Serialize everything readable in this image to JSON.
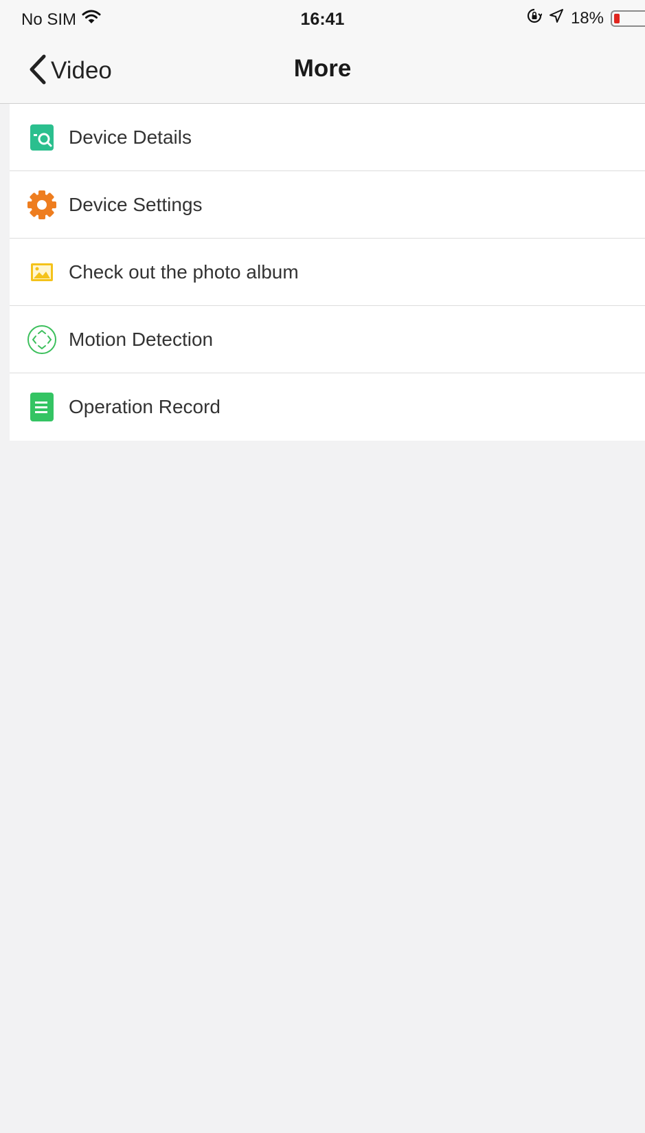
{
  "status_bar": {
    "carrier": "No SIM",
    "time": "16:41",
    "battery_percent_text": "18%",
    "battery_level": 0.18,
    "icons": [
      "wifi-icon",
      "rotation-lock-icon",
      "location-arrow-icon",
      "battery-icon"
    ]
  },
  "navbar": {
    "back_label": "Video",
    "title": "More"
  },
  "menu": {
    "items": [
      {
        "label": "Device Details",
        "icon": "device-details-icon",
        "color": "#2bbf8e"
      },
      {
        "label": "Device Settings",
        "icon": "gear-icon",
        "color": "#ee7d1f"
      },
      {
        "label": "Check out the photo album",
        "icon": "photo-album-icon",
        "color": "#f4c21a"
      },
      {
        "label": "Motion Detection",
        "icon": "motion-detection-icon",
        "color": "#3cbf5c"
      },
      {
        "label": "Operation Record",
        "icon": "operation-record-icon",
        "color": "#34c463"
      }
    ]
  }
}
